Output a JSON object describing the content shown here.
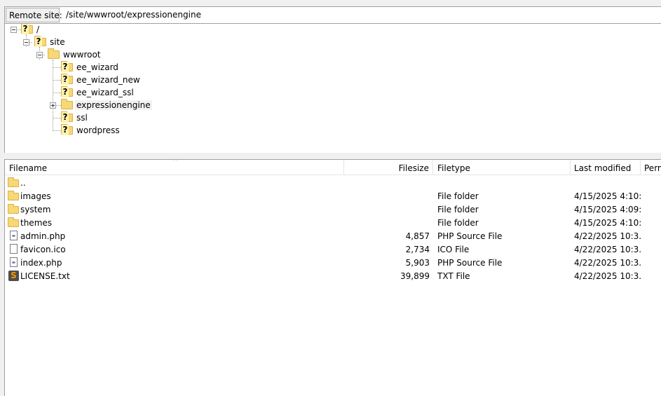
{
  "remote_site": {
    "label": "Remote site:",
    "path": "/site/wwwroot/expressionengine"
  },
  "tree": [
    {
      "name": "/",
      "icon": "question-folder-icon",
      "expanded": true
    },
    {
      "name": "site",
      "icon": "question-folder-icon",
      "expanded": true
    },
    {
      "name": "wwwroot",
      "icon": "folder-icon",
      "expanded": true
    },
    {
      "name": "ee_wizard",
      "icon": "question-folder-icon"
    },
    {
      "name": "ee_wizard_new",
      "icon": "question-folder-icon"
    },
    {
      "name": "ee_wizard_ssl",
      "icon": "question-folder-icon"
    },
    {
      "name": "expressionengine",
      "icon": "folder-icon",
      "expanded": false,
      "selected": true
    },
    {
      "name": "ssl",
      "icon": "question-folder-icon"
    },
    {
      "name": "wordpress",
      "icon": "question-folder-icon"
    }
  ],
  "list": {
    "columns": {
      "filename": "Filename",
      "filesize": "Filesize",
      "filetype": "Filetype",
      "last_modified": "Last modified",
      "permissions": "Perm"
    },
    "rows": [
      {
        "name": "..",
        "icon": "folder-icon",
        "size": "",
        "type": "",
        "modified": ""
      },
      {
        "name": "images",
        "icon": "folder-icon",
        "size": "",
        "type": "File folder",
        "modified": "4/15/2025 4:10:..."
      },
      {
        "name": "system",
        "icon": "folder-icon",
        "size": "",
        "type": "File folder",
        "modified": "4/15/2025 4:09:..."
      },
      {
        "name": "themes",
        "icon": "folder-icon",
        "size": "",
        "type": "File folder",
        "modified": "4/15/2025 4:10:..."
      },
      {
        "name": "admin.php",
        "icon": "php-file-icon",
        "size": "4,857",
        "type": "PHP Source File",
        "modified": "4/22/2025 10:3..."
      },
      {
        "name": "favicon.ico",
        "icon": "document-icon",
        "size": "2,734",
        "type": "ICO File",
        "modified": "4/22/2025 10:3..."
      },
      {
        "name": "index.php",
        "icon": "php-file-icon",
        "size": "5,903",
        "type": "PHP Source File",
        "modified": "4/22/2025 10:3..."
      },
      {
        "name": "LICENSE.txt",
        "icon": "sublime-text-icon",
        "size": "39,899",
        "type": "TXT File",
        "modified": "4/22/2025 10:3..."
      }
    ]
  }
}
